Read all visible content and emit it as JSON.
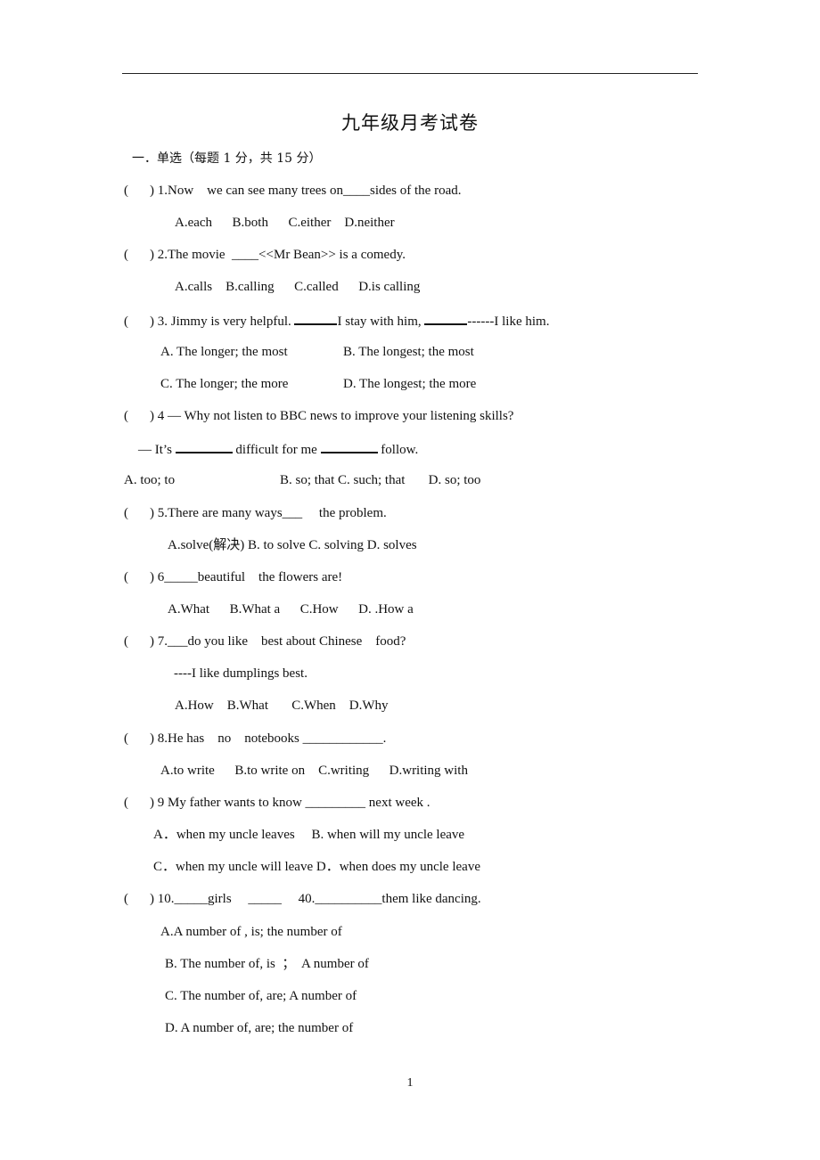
{
  "document": {
    "title": "九年级月考试卷",
    "section_heading": "一．单选（每题 1 分，共 15 分）",
    "page_number": "1"
  },
  "questions": [
    {
      "stem": ") 1.Now    we can see many trees on____sides of the road.",
      "options": [
        "A.each      B.both      C.either    D.neither"
      ]
    },
    {
      "stem": ") 2.The movie  ____<<Mr Bean>> is a comedy.",
      "options": [
        "A.calls    B.calling      C.called      D.is calling"
      ]
    },
    {
      "stem_parts": [
        ") 3. Jimmy is very helpful. ",
        "I stay with him, ",
        "------I like him."
      ],
      "options": [
        "A. The longer; the most",
        "B. The longest; the most",
        "C. The longer; the more",
        "D. The longest; the more"
      ]
    },
    {
      "stem": ") 4 — Why not listen to BBC news to improve your listening skills?",
      "followup_parts": [
        "— It’s ",
        " difficult for me ",
        " follow."
      ],
      "options": [
        "A. too; to",
        "B. so; that C. such; that       D. so; too"
      ]
    },
    {
      "stem": ") 5.There are many ways___     the problem.",
      "options": [
        "A.solve(解决) B. to solve C. solving D. solves"
      ]
    },
    {
      "stem": ") 6_____beautiful    the flowers are!",
      "options": [
        "A.What      B.What a      C.How      D. .How a"
      ]
    },
    {
      "stem": ") 7.___do you like    best about Chinese    food?",
      "followup": "----I like dumplings best.",
      "options": [
        "A.How    B.What       C.When    D.Why"
      ]
    },
    {
      "stem": ") 8.He has    no    notebooks ____________.",
      "options": [
        "A.to write      B.to write on    C.writing      D.writing with"
      ]
    },
    {
      "stem": ") 9 My father wants to know _________ next week .",
      "options": [
        "A．when my uncle leaves     B. when will my uncle leave",
        "C．when my uncle will leave D．when does my uncle leave"
      ]
    },
    {
      "stem": ") 10._____girls     _____     40.__________them like dancing.",
      "options": [
        "A.A number of , is; the number of",
        "B. The number of, is  ；  A number of",
        "C. The number of, are; A number of",
        "D. A number of, are; the number of"
      ]
    }
  ]
}
